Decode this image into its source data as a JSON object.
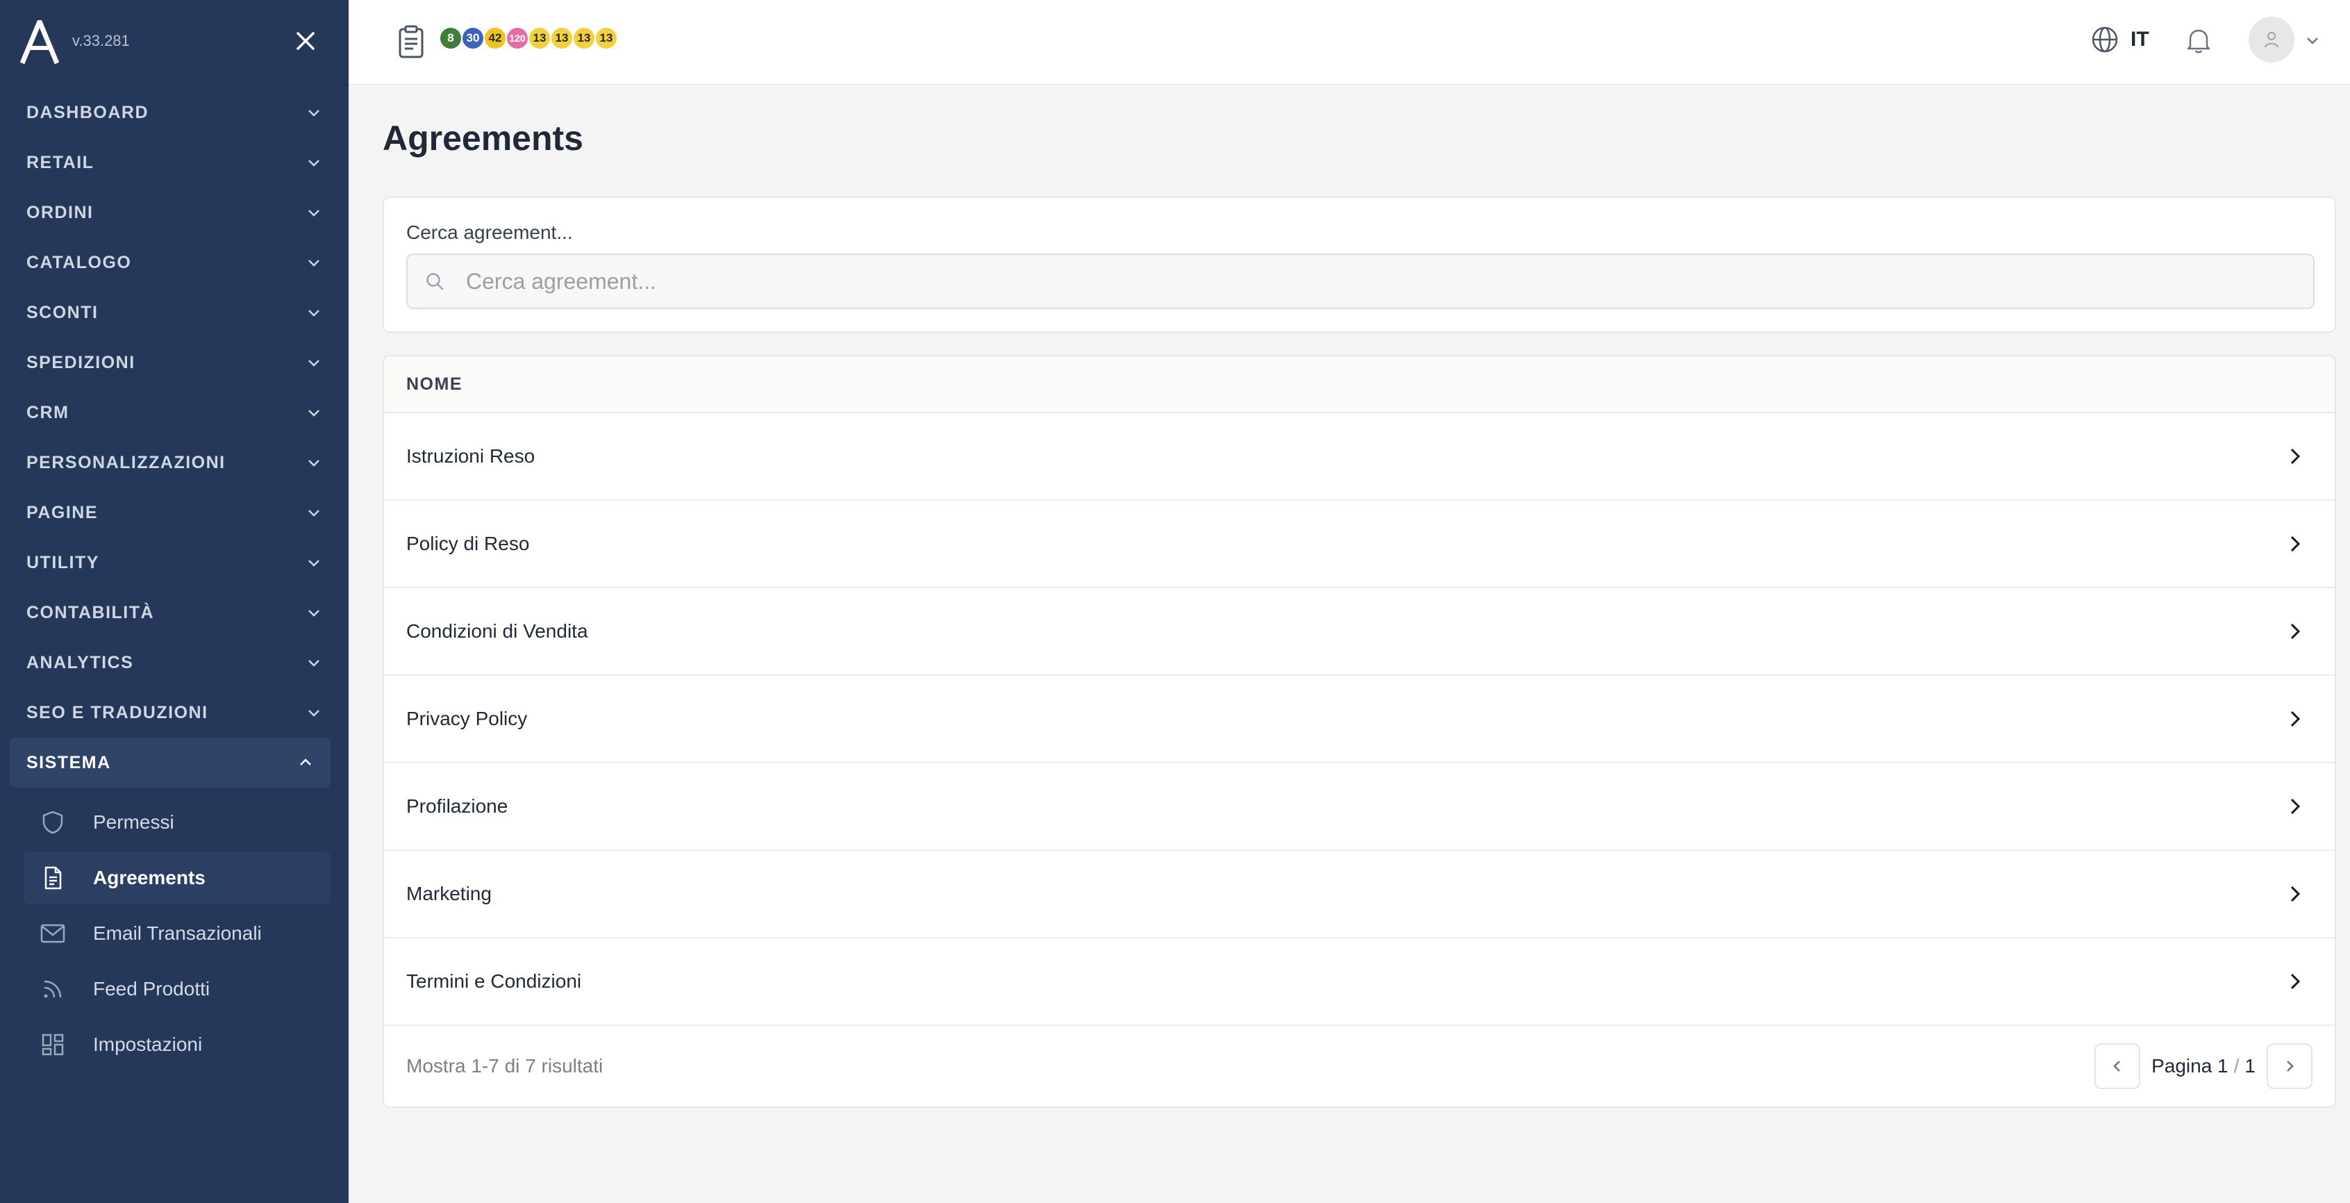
{
  "app": {
    "version": "v.33.281"
  },
  "topbar": {
    "badges": [
      {
        "value": "8",
        "bg": "#3f7d3a",
        "fg": "#ffffff"
      },
      {
        "value": "30",
        "bg": "#3b63b8",
        "fg": "#ffffff"
      },
      {
        "value": "42",
        "bg": "#f0c419",
        "fg": "#1f2937"
      },
      {
        "value": "120",
        "bg": "#e46fa7",
        "fg": "#ffffff"
      },
      {
        "value": "13",
        "bg": "#f4d03f",
        "fg": "#1f2937"
      },
      {
        "value": "13",
        "bg": "#f4d03f",
        "fg": "#1f2937"
      },
      {
        "value": "13",
        "bg": "#f4d03f",
        "fg": "#1f2937"
      },
      {
        "value": "13",
        "bg": "#f4d03f",
        "fg": "#1f2937"
      }
    ],
    "language": "IT"
  },
  "sidebar": {
    "items": [
      {
        "label": "DASHBOARD"
      },
      {
        "label": "RETAIL"
      },
      {
        "label": "ORDINI"
      },
      {
        "label": "CATALOGO"
      },
      {
        "label": "SCONTI"
      },
      {
        "label": "SPEDIZIONI"
      },
      {
        "label": "CRM"
      },
      {
        "label": "PERSONALIZZAZIONI"
      },
      {
        "label": "PAGINE"
      },
      {
        "label": "UTILITY"
      },
      {
        "label": "CONTABILITÀ"
      },
      {
        "label": "ANALYTICS"
      },
      {
        "label": "SEO E TRADUZIONI"
      }
    ],
    "open_section": {
      "label": "SISTEMA",
      "children": [
        {
          "label": "Permessi",
          "icon": "shield-icon"
        },
        {
          "label": "Agreements",
          "icon": "document-icon",
          "active": true
        },
        {
          "label": "Email Transazionali",
          "icon": "mail-icon"
        },
        {
          "label": "Feed Prodotti",
          "icon": "rss-icon"
        },
        {
          "label": "Impostazioni",
          "icon": "grid-icon"
        }
      ]
    }
  },
  "main": {
    "title": "Agreements",
    "search": {
      "label": "Cerca agreement...",
      "placeholder": "Cerca agreement...",
      "value": ""
    },
    "table": {
      "header": "NOME",
      "rows": [
        "Istruzioni Reso",
        "Policy di Reso",
        "Condizioni di Vendita",
        "Privacy Policy",
        "Profilazione",
        "Marketing",
        "Termini e Condizioni"
      ]
    },
    "footer": {
      "results": "Mostra 1-7 di 7 risultati",
      "page_label": "Pagina 1",
      "page_sep": "/",
      "page_total": "1"
    }
  }
}
